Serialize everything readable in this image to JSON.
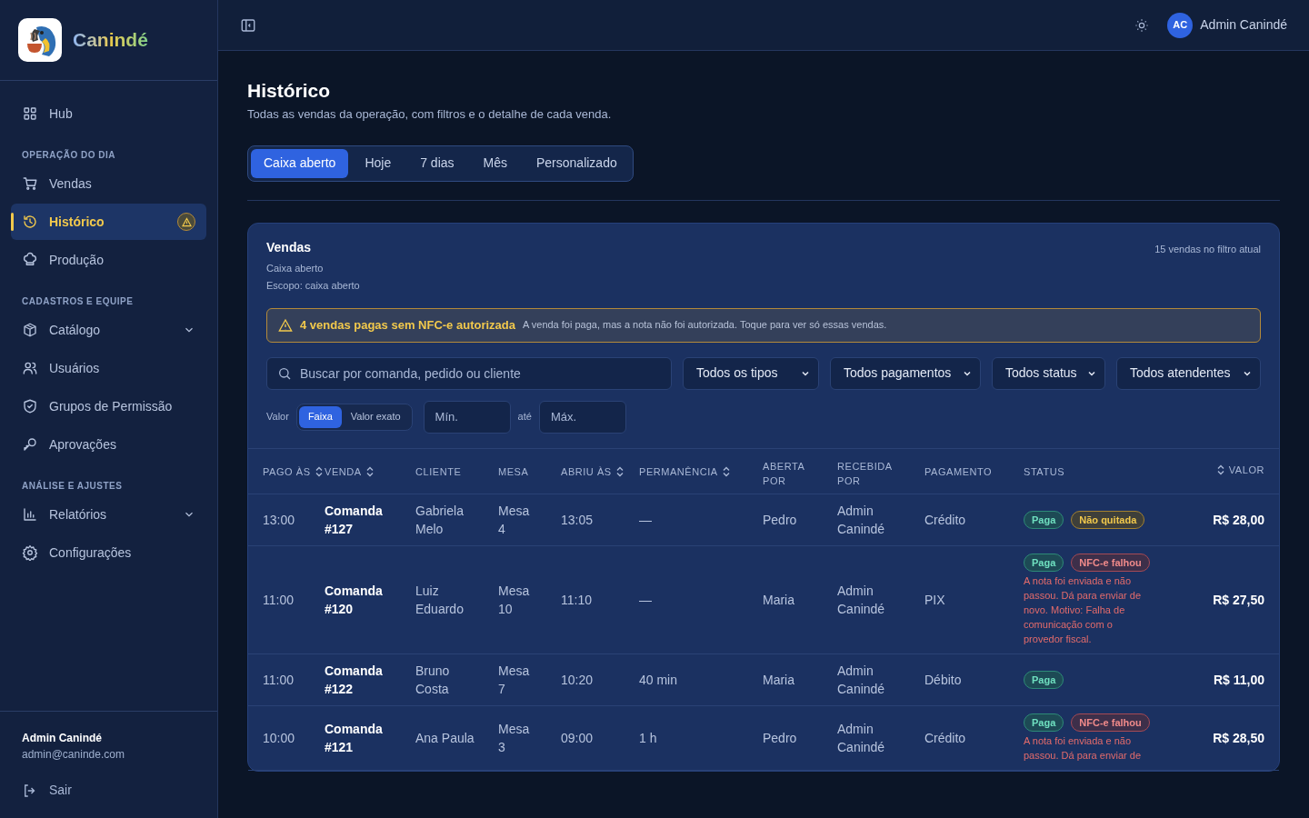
{
  "brand": {
    "name": "Canindé"
  },
  "sidebar": {
    "items": [
      {
        "kind": "item",
        "label": "Hub",
        "selected": false,
        "warning": false,
        "expandable": false
      },
      {
        "kind": "section",
        "label": "OPERAÇÃO DO DIA"
      },
      {
        "kind": "item",
        "label": "Vendas",
        "selected": false,
        "warning": false,
        "expandable": false
      },
      {
        "kind": "item",
        "label": "Histórico",
        "selected": true,
        "warning": true,
        "expandable": false
      },
      {
        "kind": "item",
        "label": "Produção",
        "selected": false,
        "warning": false,
        "expandable": false
      },
      {
        "kind": "section",
        "label": "CADASTROS E EQUIPE"
      },
      {
        "kind": "item",
        "label": "Catálogo",
        "selected": false,
        "warning": false,
        "expandable": true
      },
      {
        "kind": "item",
        "label": "Usuários",
        "selected": false,
        "warning": false,
        "expandable": false
      },
      {
        "kind": "item",
        "label": "Grupos de Permissão",
        "selected": false,
        "warning": false,
        "expandable": false
      },
      {
        "kind": "item",
        "label": "Aprovações",
        "selected": false,
        "warning": false,
        "expandable": false
      },
      {
        "kind": "section",
        "label": "ANÁLISE E AJUSTES"
      },
      {
        "kind": "item",
        "label": "Relatórios",
        "selected": false,
        "warning": false,
        "expandable": true
      },
      {
        "kind": "item",
        "label": "Configurações",
        "selected": false,
        "warning": false,
        "expandable": false
      }
    ],
    "user": {
      "name": "Admin Canindé",
      "email": "admin@caninde.com"
    },
    "logout": "Sair"
  },
  "header": {
    "avatar": "AC",
    "user": "Admin Canindé"
  },
  "page": {
    "title": "Histórico",
    "subtitle": "Todas as vendas da operação, com filtros e o detalhe de cada venda."
  },
  "tabs": [
    {
      "label": "Caixa aberto",
      "selected": true
    },
    {
      "label": "Hoje",
      "selected": false
    },
    {
      "label": "7 dias",
      "selected": false
    },
    {
      "label": "Mês",
      "selected": false
    },
    {
      "label": "Personalizado",
      "selected": false
    }
  ],
  "card": {
    "title": "Vendas",
    "subtitle": "Caixa aberto",
    "scope": "Escopo: caixa aberto",
    "count": "15 vendas no filtro atual",
    "alert": {
      "title": "4 vendas pagas sem NFC-e autorizada",
      "text": "A venda foi paga, mas a nota não foi autorizada. Toque para ver só essas vendas."
    },
    "search": {
      "placeholder": "Buscar por comanda, pedido ou cliente"
    },
    "selects": [
      "Todos os tipos",
      "Todos pagamentos",
      "Todos status",
      "Todos atendentes"
    ],
    "value_filter": {
      "label": "Valor",
      "modes": [
        {
          "label": "Faixa",
          "selected": true
        },
        {
          "label": "Valor exato",
          "selected": false
        }
      ],
      "min_placeholder": "Mín.",
      "separator": "até",
      "max_placeholder": "Máx."
    }
  },
  "table": {
    "columns": [
      {
        "label": "PAGO ÀS",
        "sortable": true
      },
      {
        "label": "VENDA",
        "sortable": true
      },
      {
        "label": "CLIENTE",
        "sortable": false
      },
      {
        "label": "MESA",
        "sortable": false
      },
      {
        "label": "ABRIU ÀS",
        "sortable": true
      },
      {
        "label": "PERMANÊNCIA",
        "sortable": true
      },
      {
        "label": "ABERTA POR",
        "sortable": false
      },
      {
        "label": "RECEBIDA POR",
        "sortable": false
      },
      {
        "label": "PAGAMENTO",
        "sortable": false
      },
      {
        "label": "STATUS",
        "sortable": false
      },
      {
        "label": "VALOR",
        "sortable": true
      }
    ],
    "rows": [
      {
        "paid_at": "13:00",
        "sale": "Comanda #127",
        "client": "Gabriela Melo",
        "table": "Mesa 4",
        "opened_at": "13:05",
        "duration": "—",
        "opened_by": "Pedro",
        "received_by": "Admin Canindé",
        "payment": "Crédito",
        "badges": [
          {
            "kind": "paid",
            "label": "Paga"
          },
          {
            "kind": "pending",
            "label": "Não quitada"
          }
        ],
        "value": "R$ 28,00"
      },
      {
        "paid_at": "11:00",
        "sale": "Comanda #120",
        "client": "Luiz Eduardo",
        "table": "Mesa 10",
        "opened_at": "11:10",
        "duration": "—",
        "opened_by": "Maria",
        "received_by": "Admin Canindé",
        "payment": "PIX",
        "badges": [
          {
            "kind": "paid",
            "label": "Paga"
          },
          {
            "kind": "failed",
            "label": "NFC-e falhou"
          }
        ],
        "note": "A nota foi enviada e não passou. Dá para enviar de novo. Motivo: Falha de comunicação com o provedor fiscal.",
        "value": "R$ 27,50"
      },
      {
        "paid_at": "11:00",
        "sale": "Comanda #122",
        "client": "Bruno Costa",
        "table": "Mesa 7",
        "opened_at": "10:20",
        "duration": "40 min",
        "opened_by": "Maria",
        "received_by": "Admin Canindé",
        "payment": "Débito",
        "badges": [
          {
            "kind": "paid",
            "label": "Paga"
          }
        ],
        "value": "R$ 11,00"
      },
      {
        "paid_at": "10:00",
        "sale": "Comanda #121",
        "client": "Ana Paula",
        "table": "Mesa 3",
        "opened_at": "09:00",
        "duration": "1 h",
        "opened_by": "Pedro",
        "received_by": "Admin Canindé",
        "payment": "Crédito",
        "badges": [
          {
            "kind": "paid",
            "label": "Paga"
          },
          {
            "kind": "failed",
            "label": "NFC-e falhou"
          }
        ],
        "note": "A nota foi enviada e não passou. Dá para enviar de",
        "value": "R$ 28,50"
      }
    ]
  }
}
